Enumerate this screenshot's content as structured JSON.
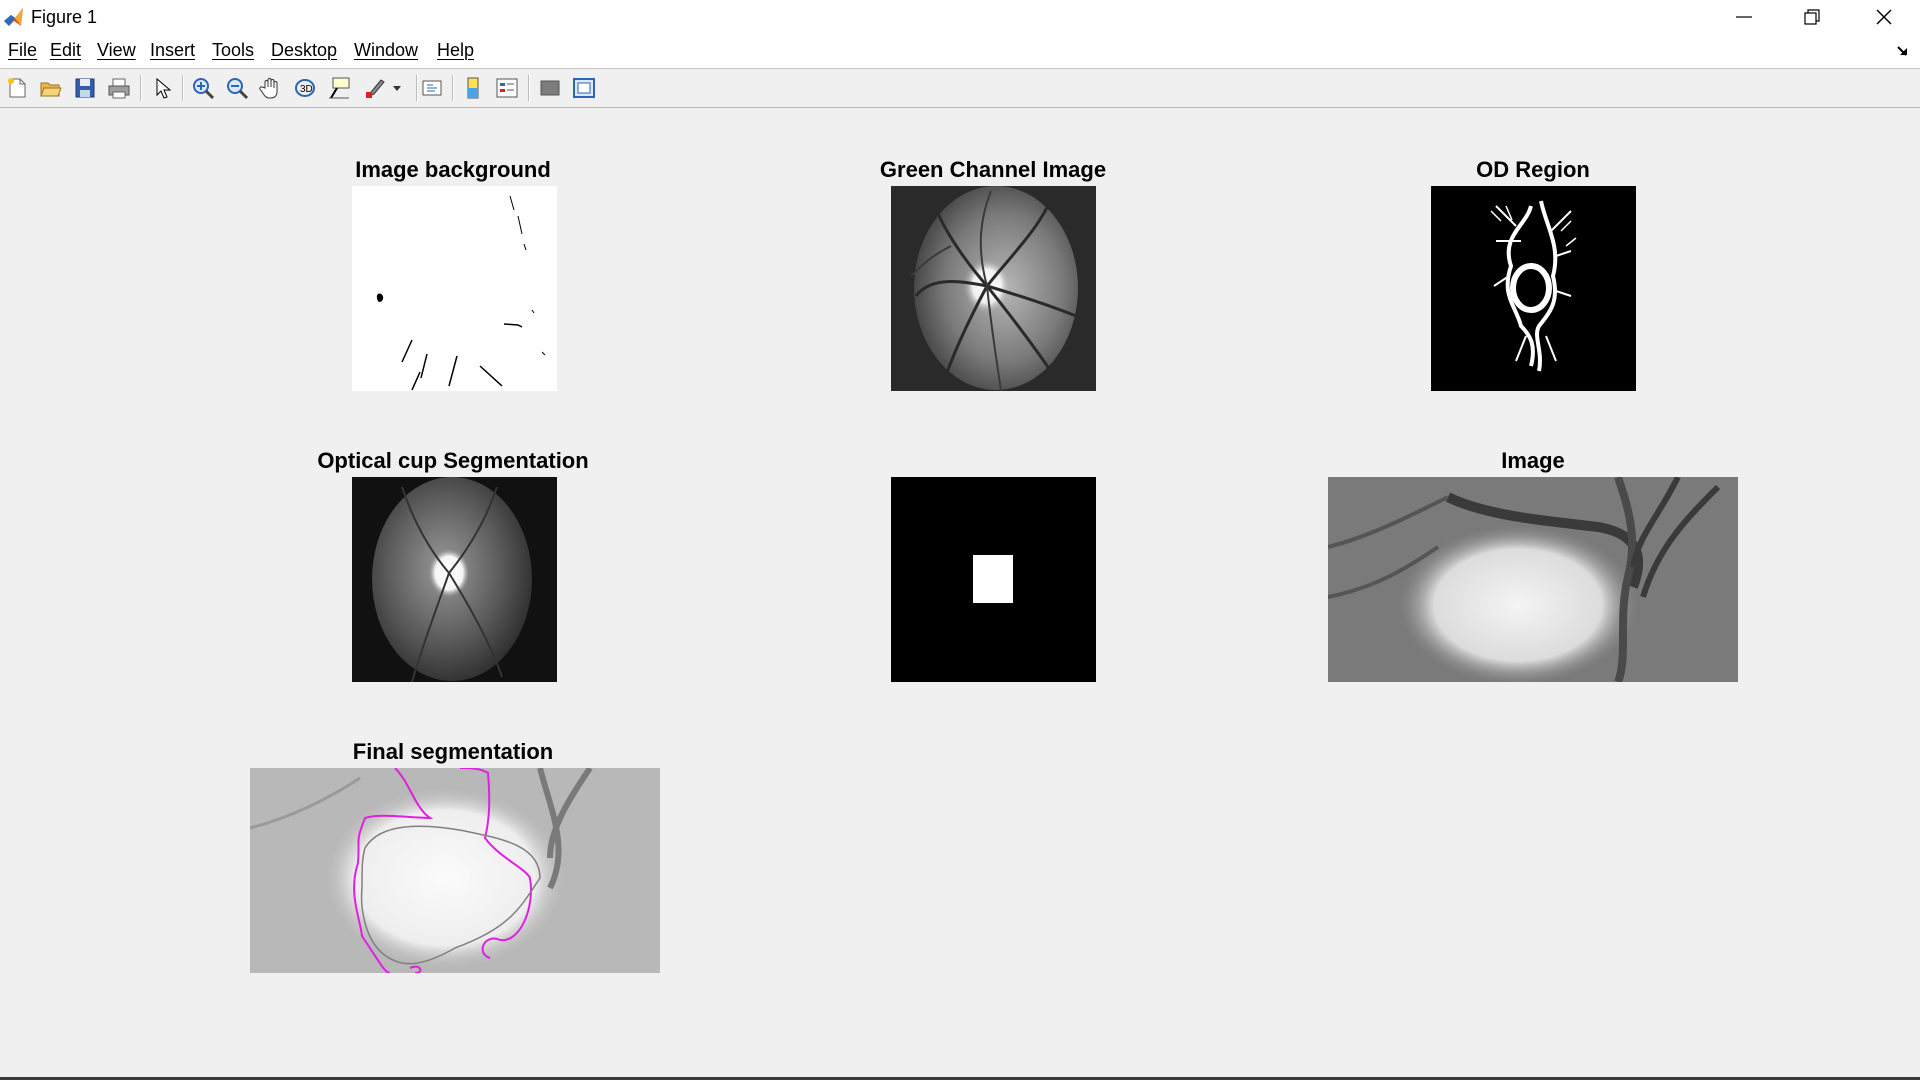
{
  "window": {
    "title": "Figure 1"
  },
  "menu": [
    "File",
    "Edit",
    "View",
    "Insert",
    "Tools",
    "Desktop",
    "Window",
    "Help"
  ],
  "toolbar": [
    "new-figure-icon",
    "open-file-icon",
    "save-icon",
    "print-icon",
    "edit-plot-arrow-icon",
    "zoom-in-icon",
    "zoom-out-icon",
    "pan-hand-icon",
    "rotate-3d-icon",
    "data-cursor-icon",
    "brush-icon",
    "link-plot-icon",
    "colorbar-icon",
    "legend-icon",
    "hide-plot-tools-icon",
    "show-plot-tools-icon"
  ],
  "subplots": [
    {
      "title": "Image background",
      "content": "binary white image with sparse black vessel fragments"
    },
    {
      "title": "Green Channel Image",
      "content": "grayscale retinal fundus image"
    },
    {
      "title": "OD Region",
      "content": "black image with white vessel structure around optic disc"
    },
    {
      "title": "Optical cup Segmentation",
      "content": "dark fundus image with bright optic cup"
    },
    {
      "title": "",
      "content": "black image with white rectangle"
    },
    {
      "title": "Image",
      "content": "cropped grayscale optic disc region"
    },
    {
      "title": "Final segmentation",
      "content": "optic disc crop with magenta and gray contours"
    }
  ],
  "colors": {
    "contour_disc": "#e020e0",
    "contour_cup": "#808080"
  }
}
